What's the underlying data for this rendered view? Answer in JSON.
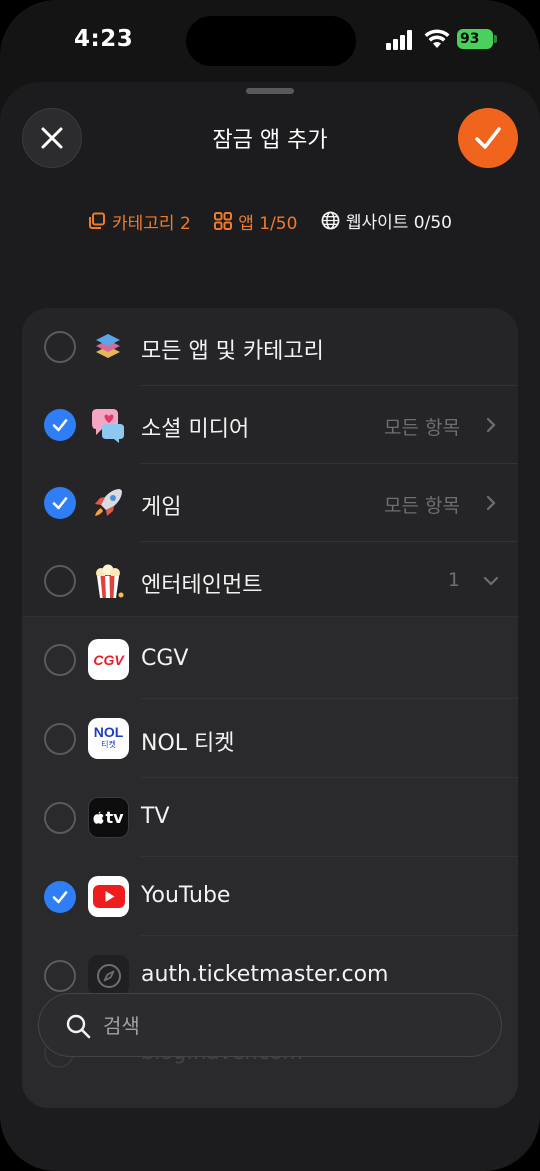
{
  "status_bar": {
    "time": "4:23",
    "battery": "93"
  },
  "header": {
    "title": "잠금 앱 추가"
  },
  "summary": {
    "categories": "카테고리 2",
    "apps": "앱 1/50",
    "websites": "웹사이트 0/50"
  },
  "list": {
    "items": [
      {
        "label": "모든 앱 및 카테고리",
        "checked": false
      },
      {
        "label": "소셜 미디어",
        "meta": "모든 항목",
        "checked": true
      },
      {
        "label": "게임",
        "meta": "모든 항목",
        "checked": true
      },
      {
        "label": "엔터테인먼트",
        "meta": "1",
        "checked": false
      },
      {
        "label": "CGV",
        "checked": false
      },
      {
        "label": "NOL 티켓",
        "checked": false
      },
      {
        "label": "TV",
        "checked": false
      },
      {
        "label": "YouTube",
        "checked": true
      },
      {
        "label": "auth.ticketmaster.com",
        "checked": false
      }
    ],
    "faded_item": "blog.naver.com"
  },
  "icons": {
    "cgv_text": "CGV",
    "nol_text": "NOL",
    "nol_sub": "티켓",
    "tv_text": "tv"
  },
  "search": {
    "placeholder": "검색"
  },
  "colors": {
    "accent": "#f0641e",
    "check": "#2f7ef5",
    "summary_active": "#f07a2a"
  }
}
